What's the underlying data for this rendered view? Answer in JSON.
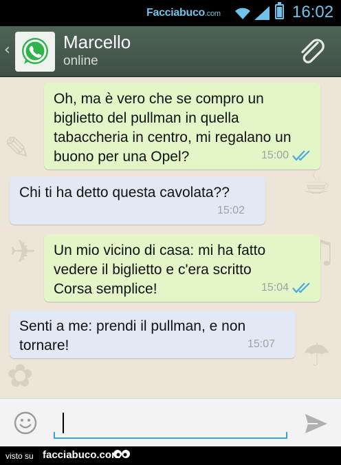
{
  "statusbar": {
    "brand_main": "Facciabuco",
    "brand_suffix": ".com",
    "time": "16:02"
  },
  "header": {
    "back_glyph": "‹",
    "contact_name": "Marcello",
    "contact_status": "online"
  },
  "messages": [
    {
      "direction": "out",
      "text": "Oh, ma è vero che se compro un biglietto del pullman in quella tabaccheria in centro, mi regalano un buono per una Opel?",
      "time": "15:00",
      "read": true
    },
    {
      "direction": "in",
      "text": "Chi ti ha detto questa cavolata??",
      "time": "15:02"
    },
    {
      "direction": "out",
      "text": "Un mio vicino di casa: mi ha fatto vedere il biglietto e c'era scritto Corsa semplice!",
      "time": "15:04",
      "read": true
    },
    {
      "direction": "in",
      "text": "Senti a me: prendi il pullman, e non tornare!",
      "time": "15:07"
    }
  ],
  "input": {
    "value": "",
    "placeholder": ""
  },
  "footer": {
    "visto": "visto su",
    "site": "facciabuco.com"
  },
  "colors": {
    "accent": "#34a6d9",
    "header": "#475a4f",
    "outgoing": "#e2f6c8",
    "incoming": "#e3e8f5",
    "read_ticks": "#4aa8e0"
  }
}
